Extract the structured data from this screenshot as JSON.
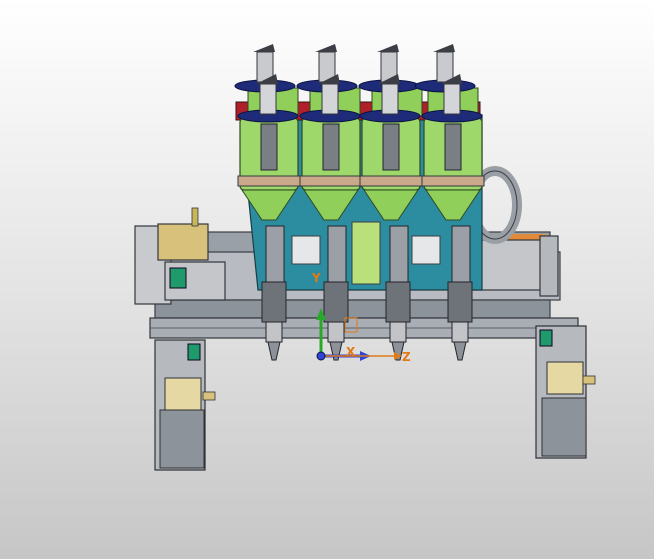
{
  "viewport": {
    "background_top": "#ffffff",
    "background_bottom": "#c6c6c6"
  },
  "model": {
    "colors": {
      "frame": "#a9aeb5",
      "frame_dark": "#4a4e55",
      "panel": "#2c8da0",
      "cylinder": "#9fd86a",
      "cylinder_dark": "#5da33a",
      "cap": "#1d2b78",
      "red_bar": "#b0202a",
      "motor": "#c8c9cc",
      "motor_end": "#d8c17a",
      "accent_green": "#1f9a6a"
    },
    "nozzle_count": 4
  },
  "triad": {
    "x_label": "X",
    "y_label": "Y",
    "z_label": "Z",
    "x_color": "#2f44d6",
    "y_color": "#2aa82a",
    "z_color": "#e07a18"
  }
}
